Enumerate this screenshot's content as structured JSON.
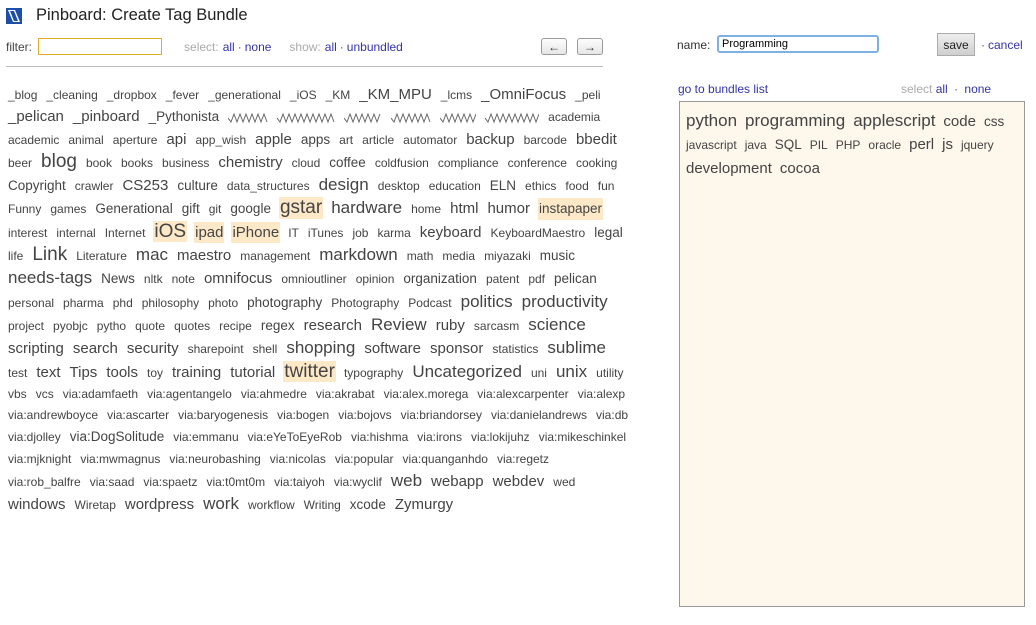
{
  "page": {
    "title": "Pinboard: Create Tag Bundle",
    "filter_label": "filter:",
    "select_label": "select:",
    "select_all": "all",
    "select_none": "none",
    "show_label": "show:",
    "show_all": "all",
    "show_unbundled": "unbundled",
    "nav_prev": "←",
    "nav_next": "→"
  },
  "right": {
    "name_label": "name:",
    "name_value": "Programming",
    "save_label": "save",
    "cancel_label": "cancel",
    "bundles_link": "go to bundles list",
    "select_label": "select",
    "select_all": "all",
    "select_none": "none"
  },
  "bundle_tags": [
    {
      "t": "python",
      "s": 4
    },
    {
      "t": "programming",
      "s": 4
    },
    {
      "t": "applescript",
      "s": 4
    },
    {
      "t": "code",
      "s": 3
    },
    {
      "t": "css",
      "s": 2
    },
    {
      "t": "javascript",
      "s": 1
    },
    {
      "t": "java",
      "s": 1
    },
    {
      "t": "SQL",
      "s": 2
    },
    {
      "t": "PIL",
      "s": 1
    },
    {
      "t": "PHP",
      "s": 1
    },
    {
      "t": "oracle",
      "s": 1
    },
    {
      "t": "perl",
      "s": 3
    },
    {
      "t": "js",
      "s": 3
    },
    {
      "t": "jquery",
      "s": 1
    },
    {
      "t": "development",
      "s": 3
    },
    {
      "t": "cocoa",
      "s": 3
    }
  ],
  "tags": [
    {
      "t": "_blog",
      "s": 1
    },
    {
      "t": "_cleaning",
      "s": 1
    },
    {
      "t": "_dropbox",
      "s": 1
    },
    {
      "t": "_fever",
      "s": 1
    },
    {
      "t": "_generational",
      "s": 1
    },
    {
      "t": "_iOS",
      "s": 1
    },
    {
      "t": "_KM",
      "s": 1
    },
    {
      "t": "_KM_MPU",
      "s": 3
    },
    {
      "t": "_lcms",
      "s": 1
    },
    {
      "t": "_OmniFocus",
      "s": 3
    },
    {
      "t": "_peli",
      "s": 1
    },
    {
      "t": "_pelican",
      "s": 3
    },
    {
      "t": "_pinboard",
      "s": 3
    },
    {
      "t": "_Pythonista",
      "s": 2
    },
    {
      "t": "",
      "s": 1,
      "squig": true,
      "w": 40
    },
    {
      "t": "",
      "s": 1,
      "squig": true,
      "w": 58
    },
    {
      "t": "",
      "s": 1,
      "squig": true,
      "w": 38
    },
    {
      "t": "",
      "s": 1,
      "squig": true,
      "w": 40
    },
    {
      "t": "",
      "s": 1,
      "squig": true,
      "w": 36
    },
    {
      "t": "",
      "s": 1,
      "squig": true,
      "w": 54
    },
    {
      "t": "academia",
      "s": 1
    },
    {
      "t": "academic",
      "s": 1
    },
    {
      "t": "animal",
      "s": 1
    },
    {
      "t": "aperture",
      "s": 1
    },
    {
      "t": "api",
      "s": 3
    },
    {
      "t": "app_wish",
      "s": 1
    },
    {
      "t": "apple",
      "s": 3
    },
    {
      "t": "apps",
      "s": 2
    },
    {
      "t": "art",
      "s": 1
    },
    {
      "t": "article",
      "s": 1
    },
    {
      "t": "automator",
      "s": 1
    },
    {
      "t": "backup",
      "s": 3
    },
    {
      "t": "barcode",
      "s": 1
    },
    {
      "t": "bbedit",
      "s": 3
    },
    {
      "t": "beer",
      "s": 1
    },
    {
      "t": "blog",
      "s": 5
    },
    {
      "t": "book",
      "s": 1
    },
    {
      "t": "books",
      "s": 1
    },
    {
      "t": "business",
      "s": 1
    },
    {
      "t": "chemistry",
      "s": 3
    },
    {
      "t": "cloud",
      "s": 1
    },
    {
      "t": "coffee",
      "s": 2
    },
    {
      "t": "coldfusion",
      "s": 1
    },
    {
      "t": "compliance",
      "s": 1
    },
    {
      "t": "conference",
      "s": 1
    },
    {
      "t": "cooking",
      "s": 1
    },
    {
      "t": "Copyright",
      "s": 2
    },
    {
      "t": "crawler",
      "s": 1
    },
    {
      "t": "CS253",
      "s": 3
    },
    {
      "t": "culture",
      "s": 2
    },
    {
      "t": "data_structures",
      "s": 1
    },
    {
      "t": "design",
      "s": 4
    },
    {
      "t": "desktop",
      "s": 1
    },
    {
      "t": "education",
      "s": 1
    },
    {
      "t": "ELN",
      "s": 2
    },
    {
      "t": "ethics",
      "s": 1
    },
    {
      "t": "food",
      "s": 1
    },
    {
      "t": "fun",
      "s": 1
    },
    {
      "t": "Funny",
      "s": 1
    },
    {
      "t": "games",
      "s": 1
    },
    {
      "t": "Generational",
      "s": 2
    },
    {
      "t": "gift",
      "s": 2
    },
    {
      "t": "git",
      "s": 1
    },
    {
      "t": "google",
      "s": 2
    },
    {
      "t": "gstar",
      "s": 5,
      "hl": true
    },
    {
      "t": "hardware",
      "s": 4
    },
    {
      "t": "home",
      "s": 1
    },
    {
      "t": "html",
      "s": 3
    },
    {
      "t": "humor",
      "s": 3
    },
    {
      "t": "instapaper",
      "s": 2,
      "hl": true
    },
    {
      "t": "interest",
      "s": 1
    },
    {
      "t": "internal",
      "s": 1
    },
    {
      "t": "Internet",
      "s": 1
    },
    {
      "t": "iOS",
      "s": 5,
      "hl": true
    },
    {
      "t": "ipad",
      "s": 3,
      "hl": true
    },
    {
      "t": "iPhone",
      "s": 3,
      "hl": true
    },
    {
      "t": "IT",
      "s": 1
    },
    {
      "t": "iTunes",
      "s": 1
    },
    {
      "t": "job",
      "s": 1
    },
    {
      "t": "karma",
      "s": 1
    },
    {
      "t": "keyboard",
      "s": 3
    },
    {
      "t": "KeyboardMaestro",
      "s": 1
    },
    {
      "t": "legal",
      "s": 2
    },
    {
      "t": "life",
      "s": 1
    },
    {
      "t": "Link",
      "s": 5
    },
    {
      "t": "Literature",
      "s": 1
    },
    {
      "t": "mac",
      "s": 4
    },
    {
      "t": "maestro",
      "s": 3
    },
    {
      "t": "management",
      "s": 1
    },
    {
      "t": "markdown",
      "s": 4
    },
    {
      "t": "math",
      "s": 1
    },
    {
      "t": "media",
      "s": 1
    },
    {
      "t": "miyazaki",
      "s": 1
    },
    {
      "t": "music",
      "s": 2
    },
    {
      "t": "needs-tags",
      "s": 4
    },
    {
      "t": "News",
      "s": 2
    },
    {
      "t": "nltk",
      "s": 1
    },
    {
      "t": "note",
      "s": 1
    },
    {
      "t": "omnifocus",
      "s": 3
    },
    {
      "t": "omnioutliner",
      "s": 1
    },
    {
      "t": "opinion",
      "s": 1
    },
    {
      "t": "organization",
      "s": 2
    },
    {
      "t": "patent",
      "s": 1
    },
    {
      "t": "pdf",
      "s": 1
    },
    {
      "t": "pelican",
      "s": 2
    },
    {
      "t": "personal",
      "s": 1
    },
    {
      "t": "pharma",
      "s": 1
    },
    {
      "t": "phd",
      "s": 1
    },
    {
      "t": "philosophy",
      "s": 1
    },
    {
      "t": "photo",
      "s": 1
    },
    {
      "t": "photography",
      "s": 2
    },
    {
      "t": "Photography",
      "s": 1
    },
    {
      "t": "Podcast",
      "s": 1
    },
    {
      "t": "politics",
      "s": 4
    },
    {
      "t": "productivity",
      "s": 4
    },
    {
      "t": "project",
      "s": 1
    },
    {
      "t": "pyobjc",
      "s": 1
    },
    {
      "t": "pytho",
      "s": 1
    },
    {
      "t": "quote",
      "s": 1
    },
    {
      "t": "quotes",
      "s": 1
    },
    {
      "t": "recipe",
      "s": 1
    },
    {
      "t": "regex",
      "s": 2
    },
    {
      "t": "research",
      "s": 3
    },
    {
      "t": "Review",
      "s": 4
    },
    {
      "t": "ruby",
      "s": 3
    },
    {
      "t": "sarcasm",
      "s": 1
    },
    {
      "t": "science",
      "s": 4
    },
    {
      "t": "scripting",
      "s": 3
    },
    {
      "t": "search",
      "s": 3
    },
    {
      "t": "security",
      "s": 3
    },
    {
      "t": "sharepoint",
      "s": 1
    },
    {
      "t": "shell",
      "s": 1
    },
    {
      "t": "shopping",
      "s": 4
    },
    {
      "t": "software",
      "s": 3
    },
    {
      "t": "sponsor",
      "s": 3
    },
    {
      "t": "statistics",
      "s": 1
    },
    {
      "t": "sublime",
      "s": 4
    },
    {
      "t": "test",
      "s": 1
    },
    {
      "t": "text",
      "s": 3
    },
    {
      "t": "Tips",
      "s": 3
    },
    {
      "t": "tools",
      "s": 3
    },
    {
      "t": "toy",
      "s": 1
    },
    {
      "t": "training",
      "s": 3
    },
    {
      "t": "tutorial",
      "s": 3
    },
    {
      "t": "twitter",
      "s": 5,
      "hl": true
    },
    {
      "t": "typography",
      "s": 1
    },
    {
      "t": "Uncategorized",
      "s": 4
    },
    {
      "t": "uni",
      "s": 1
    },
    {
      "t": "unix",
      "s": 4
    },
    {
      "t": "utility",
      "s": 1
    },
    {
      "t": "vbs",
      "s": 1
    },
    {
      "t": "vcs",
      "s": 1
    },
    {
      "t": "via:adamfaeth",
      "s": 1
    },
    {
      "t": "via:agentangelo",
      "s": 1
    },
    {
      "t": "via:ahmedre",
      "s": 1
    },
    {
      "t": "via:akrabat",
      "s": 1
    },
    {
      "t": "via:alex.morega",
      "s": 1
    },
    {
      "t": "via:alexcarpenter",
      "s": 1
    },
    {
      "t": "via:alexp",
      "s": 1
    },
    {
      "t": "via:andrewboyce",
      "s": 1
    },
    {
      "t": "via:ascarter",
      "s": 1
    },
    {
      "t": "via:baryogenesis",
      "s": 1
    },
    {
      "t": "via:bogen",
      "s": 1
    },
    {
      "t": "via:bojovs",
      "s": 1
    },
    {
      "t": "via:briandorsey",
      "s": 1
    },
    {
      "t": "via:danielandrews",
      "s": 1
    },
    {
      "t": "via:db",
      "s": 1
    },
    {
      "t": "via:djolley",
      "s": 1
    },
    {
      "t": "via:DogSolitude",
      "s": 2
    },
    {
      "t": "via:emmanu",
      "s": 1
    },
    {
      "t": "via:eYeToEyeRob",
      "s": 1
    },
    {
      "t": "via:hishma",
      "s": 1
    },
    {
      "t": "via:irons",
      "s": 1
    },
    {
      "t": "via:lokijuhz",
      "s": 1
    },
    {
      "t": "via:mikeschinkel",
      "s": 1
    },
    {
      "t": "via:mjknight",
      "s": 1
    },
    {
      "t": "via:mwmagnus",
      "s": 1
    },
    {
      "t": "via:neurobashing",
      "s": 1
    },
    {
      "t": "via:nicolas",
      "s": 1
    },
    {
      "t": "via:popular",
      "s": 1
    },
    {
      "t": "via:quanganhdo",
      "s": 1
    },
    {
      "t": "via:regetz",
      "s": 1
    },
    {
      "t": "via:rob_balfre",
      "s": 1
    },
    {
      "t": "via:saad",
      "s": 1
    },
    {
      "t": "via:spaetz",
      "s": 1
    },
    {
      "t": "via:t0mt0m",
      "s": 1
    },
    {
      "t": "via:taiyoh",
      "s": 1
    },
    {
      "t": "via:wyclif",
      "s": 1
    },
    {
      "t": "web",
      "s": 4
    },
    {
      "t": "webapp",
      "s": 3
    },
    {
      "t": "webdev",
      "s": 3
    },
    {
      "t": "wed",
      "s": 1
    },
    {
      "t": "windows",
      "s": 3
    },
    {
      "t": "Wiretap",
      "s": 1
    },
    {
      "t": "wordpress",
      "s": 3
    },
    {
      "t": "work",
      "s": 4
    },
    {
      "t": "workflow",
      "s": 1
    },
    {
      "t": "Writing",
      "s": 1
    },
    {
      "t": "xcode",
      "s": 2
    },
    {
      "t": "Zymurgy",
      "s": 3
    }
  ],
  "colors": {
    "accent": "#3333aa",
    "highlight": "#fde9c8",
    "panel_bg": "#fdf7ec"
  }
}
